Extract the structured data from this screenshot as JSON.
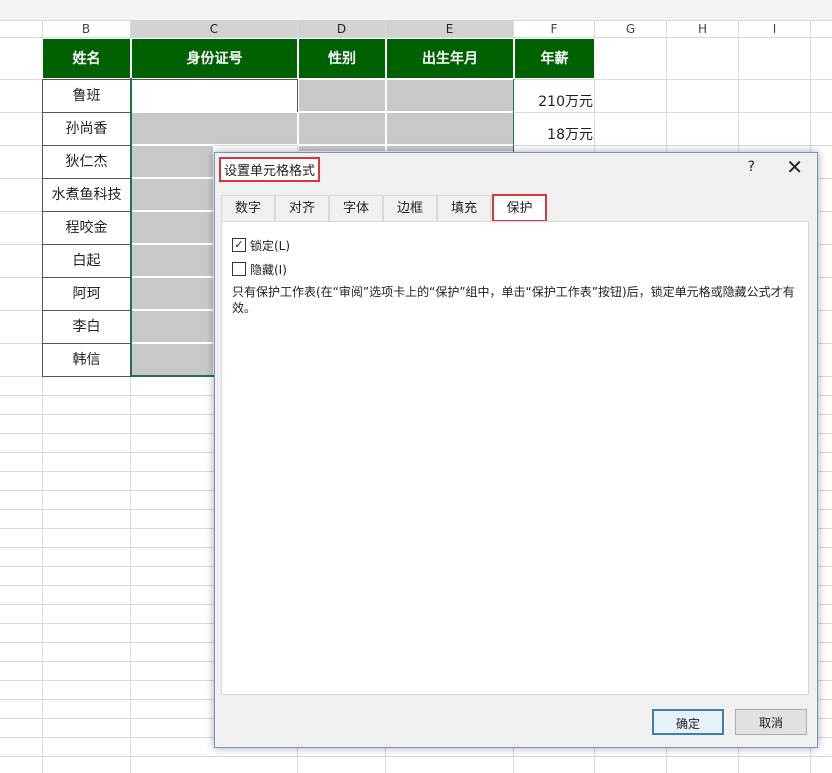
{
  "columns": [
    "B",
    "C",
    "D",
    "E",
    "F",
    "G",
    "H",
    "I"
  ],
  "header": {
    "name": "姓名",
    "id": "身份证号",
    "gender": "性别",
    "birth": "出生年月",
    "salary": "年薪"
  },
  "rows": [
    {
      "name": "鲁班",
      "salary": "210万元"
    },
    {
      "name": "孙尚香",
      "salary": "18万元"
    },
    {
      "name": "狄仁杰"
    },
    {
      "name": "水煮鱼科技"
    },
    {
      "name": "程咬金"
    },
    {
      "name": "白起"
    },
    {
      "name": "阿珂"
    },
    {
      "name": "李白"
    },
    {
      "name": "韩信"
    }
  ],
  "dialog": {
    "title": "设置单元格格式",
    "help": "?",
    "close": "✕",
    "tabs": [
      "数字",
      "对齐",
      "字体",
      "边框",
      "填充",
      "保护"
    ],
    "active_tab": "保护",
    "locked_label": "锁定(L)",
    "locked_checked": true,
    "hidden_label": "隐藏(I)",
    "hidden_checked": false,
    "note": "只有保护工作表(在“审阅”选项卡上的“保护”组中，单击“保护工作表”按钮)后，锁定单元格或隐藏公式才有效。",
    "ok": "确定",
    "cancel": "取消"
  },
  "colors": {
    "header_bg": "#006100",
    "highlight": "#d9363e",
    "gray_cell": "#c8c8c8"
  }
}
